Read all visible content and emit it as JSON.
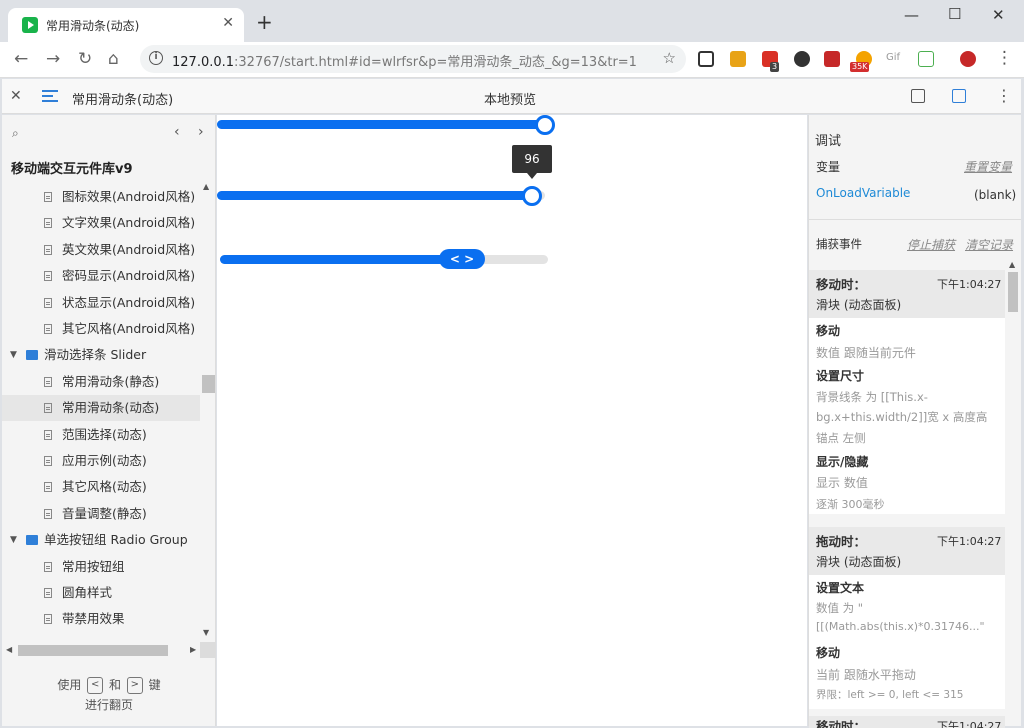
{
  "browser": {
    "tab_title": "常用滑动条(动态)",
    "tab_close": "✕",
    "new_tab": "+",
    "url_host": "127.0.0.1",
    "url_rest": ":32767/start.html#id=wlrfsr&p=常用滑动条_动态_&g=13&tr=1",
    "ext_badge_3": "3",
    "ext_badge_35k": "35K",
    "ext_gif": "Gif"
  },
  "axure": {
    "close": "✕",
    "page_title": "常用滑动条(动态)",
    "center_title": "本地预览"
  },
  "sidebar": {
    "library": "移动端交互元件库v9",
    "items": [
      {
        "label": "图标效果(Android风格)",
        "type": "page"
      },
      {
        "label": "文字效果(Android风格)",
        "type": "page"
      },
      {
        "label": "英文效果(Android风格)",
        "type": "page"
      },
      {
        "label": "密码显示(Android风格)",
        "type": "page"
      },
      {
        "label": "状态显示(Android风格)",
        "type": "page"
      },
      {
        "label": "其它风格(Android风格)",
        "type": "page"
      },
      {
        "label": "滑动选择条 Slider",
        "type": "folder"
      },
      {
        "label": "常用滑动条(静态)",
        "type": "page"
      },
      {
        "label": "常用滑动条(动态)",
        "type": "page",
        "selected": true
      },
      {
        "label": "范围选择(动态)",
        "type": "page"
      },
      {
        "label": "应用示例(动态)",
        "type": "page"
      },
      {
        "label": "其它风格(动态)",
        "type": "page"
      },
      {
        "label": "音量调整(静态)",
        "type": "page"
      },
      {
        "label": "单选按钮组 Radio Group",
        "type": "folder"
      },
      {
        "label": "常用按钮组",
        "type": "page"
      },
      {
        "label": "圆角样式",
        "type": "page"
      },
      {
        "label": "带禁用效果",
        "type": "page"
      }
    ],
    "footer_use": "使用",
    "footer_and": "和",
    "footer_key": "键",
    "footer_line2": "进行翻页",
    "key_left": "<",
    "key_right": ">"
  },
  "canvas": {
    "slider1_value": 1.0,
    "slider2_value": 0.96,
    "slider2_tooltip": "96",
    "slider3_value": 0.73,
    "slider3_handle_icon": "< >"
  },
  "panel": {
    "debug": "调试",
    "variables": "变量",
    "reset_variables": "重置变量",
    "var_name": "OnLoadVariable",
    "var_value": "(blank)",
    "capture_events": "捕获事件",
    "stop_capture": "停止捕获",
    "clear_log": "清空记录",
    "ev1_title": "移动时：",
    "ev1_time": "下午1:04:27",
    "ev1_target": "滑块 (动态面板)",
    "ev1_a1": "移动",
    "ev1_a1_d": "数值 跟随当前元件",
    "ev1_a2": "设置尺寸",
    "ev1_a2_d1": "背景线条 为 [[This.x-",
    "ev1_a2_d2": "bg.x+this.width/2]]宽 x 高度高",
    "ev1_a2_d3": "锚点 左侧",
    "ev1_a3": "显示/隐藏",
    "ev1_a3_d1": "显示 数值",
    "ev1_a3_d2": "逐渐 300毫秒",
    "ev2_title": "拖动时：",
    "ev2_time": "下午1:04:27",
    "ev2_target": "滑块 (动态面板)",
    "ev2_a1": "设置文本",
    "ev2_a1_d1": "数值 为 \"",
    "ev2_a1_d2": "[[(Math.abs(this.x)*0.31746...\"",
    "ev2_a2": "移动",
    "ev2_a2_d1": "当前 跟随水平拖动",
    "ev2_a2_d2": "界限：left >= 0, left <= 315",
    "ev3_title": "移动时：",
    "ev3_time": "下午1:04:27"
  },
  "colors": {
    "accent": "#0a6ff0",
    "folder": "#2f7fd8"
  }
}
